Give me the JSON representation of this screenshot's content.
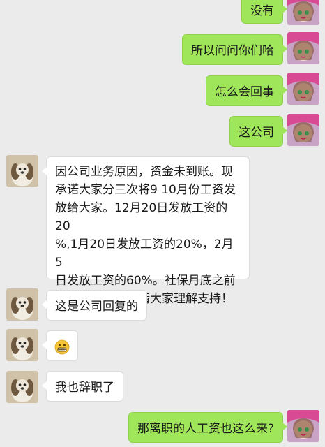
{
  "messages": [
    {
      "side": "self",
      "text": "没有"
    },
    {
      "side": "self",
      "text": "所以问问你们哈"
    },
    {
      "side": "self",
      "text": "怎么会回事"
    },
    {
      "side": "self",
      "text": "这公司"
    },
    {
      "side": "other",
      "lines": [
        "因公司业务原因，资金未到账。现",
        "承诺大家分三次将9 10月份工资发",
        "放给大家。12月20日发放工资的20",
        "%,1月20日发放工资的20%，2月5",
        "日发放工资的60%。社保月底之前",
        "全部缴纳完成！请大家理解支持！"
      ]
    },
    {
      "side": "other",
      "text": "这是公司回复的"
    },
    {
      "side": "other",
      "emoji": "grimacing-face-emoji"
    },
    {
      "side": "other",
      "text": "我也辞职了"
    },
    {
      "side": "self",
      "text": "那离职的人工资也这么来?"
    }
  ],
  "colors": {
    "background": "#ebebeb",
    "self_bubble": "#9fe65a",
    "other_bubble": "#ffffff"
  }
}
